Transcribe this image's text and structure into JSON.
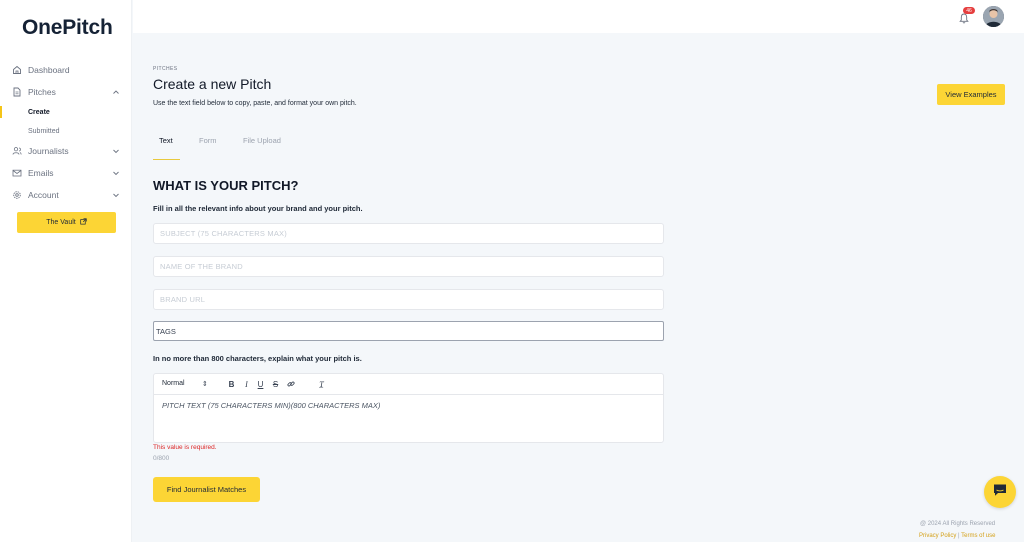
{
  "app": {
    "logo": "OnePitch"
  },
  "sidebar": {
    "items": [
      {
        "label": "Dashboard",
        "icon": "home-icon"
      },
      {
        "label": "Pitches",
        "icon": "document-icon",
        "expanded": true,
        "children": [
          {
            "label": "Create",
            "active": true
          },
          {
            "label": "Submitted"
          }
        ]
      },
      {
        "label": "Journalists",
        "icon": "users-icon"
      },
      {
        "label": "Emails",
        "icon": "mail-icon"
      },
      {
        "label": "Account",
        "icon": "gear-icon"
      }
    ],
    "vault_label": "The Vault"
  },
  "topbar": {
    "notification_count": "46"
  },
  "header": {
    "breadcrumb": "PITCHES",
    "title": "Create a new Pitch",
    "description": "Use the text field below to copy, paste, and format your own pitch.",
    "examples_button": "View Examples"
  },
  "tabs": [
    {
      "label": "Text",
      "active": true
    },
    {
      "label": "Form"
    },
    {
      "label": "File Upload"
    }
  ],
  "form": {
    "title": "WHAT IS YOUR PITCH?",
    "description": "Fill in all the relevant info about your brand and your pitch.",
    "subject_placeholder": "SUBJECT (75 CHARACTERS MAX)",
    "brand_placeholder": "NAME OF THE BRAND",
    "url_placeholder": "BRAND URL",
    "tags_label": "TAGS",
    "limit_text": "In no more than 800 characters, explain what your pitch is.",
    "editor": {
      "format": "Normal",
      "placeholder": "PITCH TEXT (75 CHARACTERS MIN)(800 CHARACTERS MAX)"
    },
    "error": "This value is required.",
    "counter": "0/800",
    "submit": "Find Journalist Matches"
  },
  "footer": {
    "copyright": "@ 2024 All Rights Reserved",
    "privacy": "Privacy Policy",
    "separator": "|",
    "terms": "Terms of use"
  },
  "colors": {
    "accent": "#fcd535",
    "error": "#dc2626",
    "title": "#152235"
  }
}
